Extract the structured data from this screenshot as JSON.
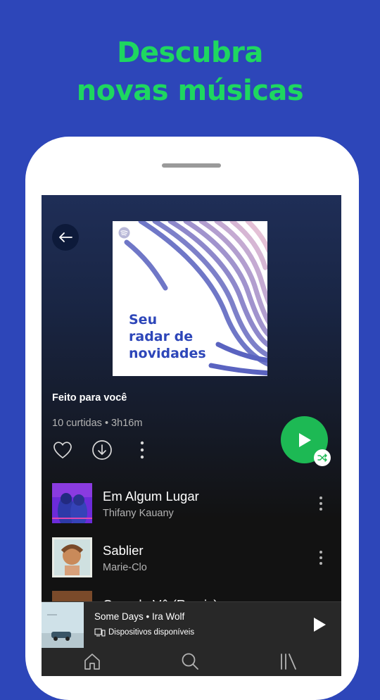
{
  "headline": {
    "line1": "Descubra",
    "line2": "novas músicas"
  },
  "playlist": {
    "cover_title_1": "Seu",
    "cover_title_2": "radar de",
    "cover_title_3": "novidades",
    "made_for": "Feito para você",
    "meta": "10 curtidas • 3h16m"
  },
  "tracks": [
    {
      "name": "Em Algum Lugar",
      "artist": "Thifany Kauany"
    },
    {
      "name": "Sablier",
      "artist": "Marie-Clo"
    },
    {
      "name": "Quando Vê (Remix)",
      "artist": ""
    }
  ],
  "now_playing": {
    "title": "Some Days • Ira Wolf",
    "device": "Dispositivos disponíveis"
  },
  "tabs": [
    {
      "icon": "home-icon"
    },
    {
      "icon": "search-icon"
    },
    {
      "icon": "library-icon"
    }
  ],
  "colors": {
    "background": "#2d46b9",
    "accent": "#1ed760",
    "play_button": "#1db954",
    "screen_bg": "#121212"
  }
}
